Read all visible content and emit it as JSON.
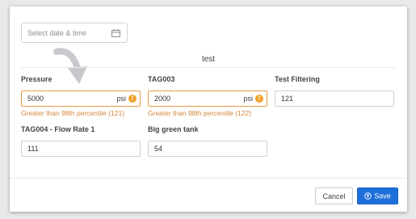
{
  "date_picker": {
    "placeholder": "Select date & time",
    "icon": "calendar-icon"
  },
  "section": {
    "title": "test"
  },
  "fields": {
    "pressure": {
      "label": "Pressure",
      "value": "5000",
      "unit": "psi",
      "error": "Greater than 98th percentile (121)"
    },
    "tag003": {
      "label": "TAG003",
      "value": "2000",
      "unit": "psi",
      "error": "Greater than 98th percentile (122)"
    },
    "test_filtering": {
      "label": "Test Filtering",
      "value": "121"
    },
    "flow_rate": {
      "label": "TAG004 - Flow Rate 1",
      "value": "111"
    },
    "big_green_tank": {
      "label": "Big green tank",
      "value": "54"
    }
  },
  "footer": {
    "cancel_label": "Cancel",
    "save_label": "Save"
  },
  "colors": {
    "accent": "#1e6ed9",
    "warning": "#e59b45",
    "error_text": "#d6843a"
  }
}
